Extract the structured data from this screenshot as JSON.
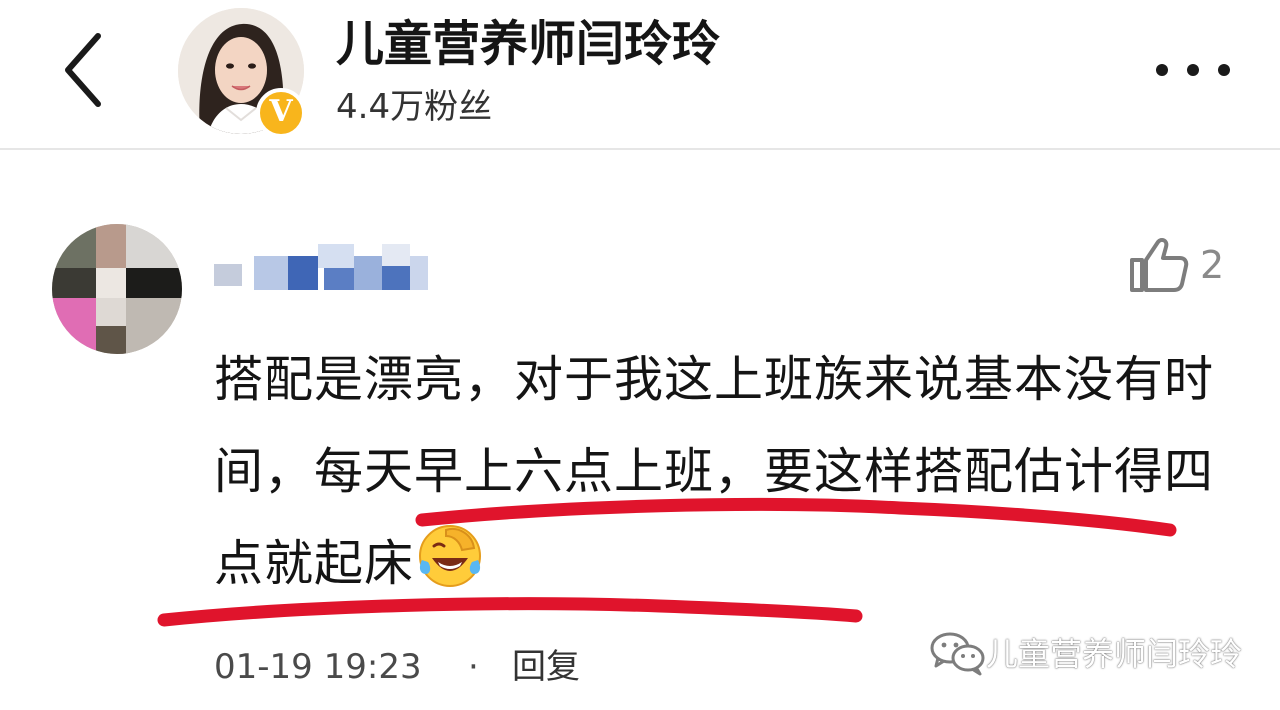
{
  "header": {
    "profile_name": "儿童营养师闫玲玲",
    "fans_count": "4.4万粉丝",
    "verified_badge": "V",
    "icons": {
      "back": "chevron-left-icon",
      "more": "more-dots-icon",
      "verified": "verified-badge-icon"
    }
  },
  "comment": {
    "username": "",
    "like_count": "2",
    "text_before": "搭配是漂亮，对于我这上班族来说基本没有时间，",
    "text_highlight": "每天早上六点上班，要这样搭配估计得四点就起床",
    "emoji": "laugh-crying-emoji",
    "date": "01-19 19:23",
    "separator": "·",
    "reply_label": "回复",
    "icons": {
      "like": "thumbs-up-icon"
    }
  },
  "watermark": {
    "text": "儿童营养师闫玲玲",
    "icon": "wechat-icon"
  },
  "colors": {
    "annotation_red": "#e0142c",
    "badge_gold": "#f8b51c",
    "divider": "#e6e6e6"
  }
}
